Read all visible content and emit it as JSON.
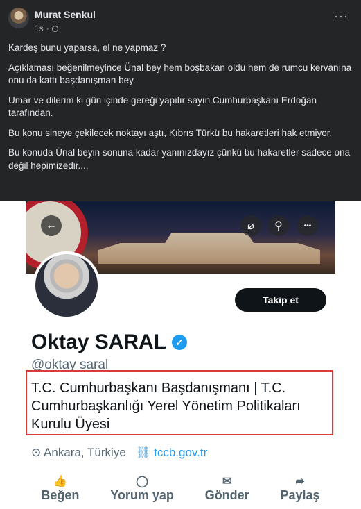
{
  "post": {
    "author": "Murat Senkul",
    "time": "1s",
    "dot": "·",
    "more": "···",
    "paragraphs": [
      "Kardeş bunu yaparsa, el ne yapmaz ?",
      "Açıklaması beğenilmeyince Ünal bey hem boşbakan oldu hem de rumcu kervanına onu da kattı başdanışman bey.",
      "Umar ve dilerim ki gün içinde gereği yapılır sayın Cumhurbaşkanı Erdoğan tarafından.",
      "Bu konu sineye çekilecek noktayı aştı, Kıbrıs Türkü bu hakaretleri hak etmiyor.",
      "Bu konuda Ünal beyin sonuna kadar yanınızdayız çünkü bu hakaretler sadece ona değil hepimizedir...."
    ]
  },
  "profile": {
    "follow_label": "Takip et",
    "name": "Oktay SARAL",
    "verified": "✓",
    "handle": "@oktay saral",
    "bio": "T.C. Cumhurbaşkanı Başdanışmanı | T.C. Cumhurbaşkanlığı Yerel Yönetim Politikaları Kurulu Üyesi",
    "location": "Ankara, Türkiye",
    "website": "tccb.gov.tr",
    "icons": {
      "back": "←",
      "mute": "⌀",
      "search": "⚲",
      "more": "•••",
      "location": "⊙",
      "link": "⛓"
    }
  },
  "actions": [
    {
      "label": "Beğen",
      "icon": "👍"
    },
    {
      "label": "Yorum yap",
      "icon": "◯"
    },
    {
      "label": "Gönder",
      "icon": "✉"
    },
    {
      "label": "Paylaş",
      "icon": "➦"
    }
  ],
  "colors": {
    "post_bg": "#242526",
    "accent": "#1d9bf0",
    "highlight": "#d93a3a"
  }
}
